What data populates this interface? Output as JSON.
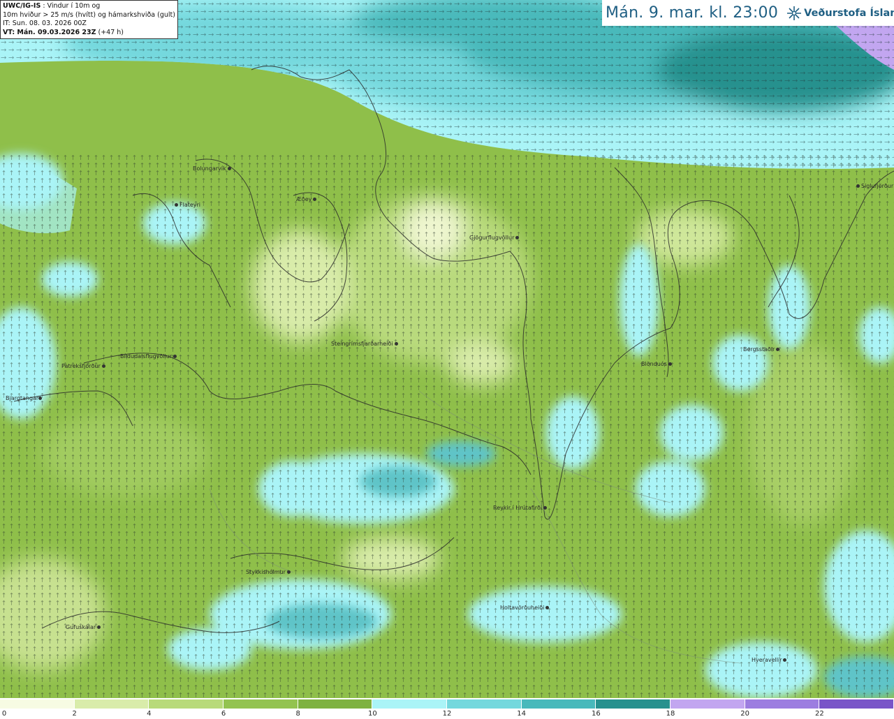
{
  "info": {
    "model": "UWC/IG-IS",
    "line1_rest": " : Vindur í 10m og",
    "line2": "10m hviður > 25 m/s (hvítt) og hámarkshviða (gult)",
    "line3": "IT: Sun. 08. 03. 2026 00Z",
    "vt_bold": "VT: Mán. 09.03.2026 23Z",
    "vt_rest": " (+47 h)"
  },
  "header": {
    "datetime": "Mán. 9. mar. kl. 23:00",
    "brand": "Veðurstofa Íslands",
    "logo_icon": "snowflake-compass-icon"
  },
  "places": [
    {
      "name": "Bolungarvík"
    },
    {
      "name": "Flateyri"
    },
    {
      "name": "Æðey"
    },
    {
      "name": "Gjögurflugvöllur"
    },
    {
      "name": "Siglufjörður"
    },
    {
      "name": "Steingrímsfjarðarheiði"
    },
    {
      "name": "Bíldudalsflugvöllur"
    },
    {
      "name": "Patreksfjörður"
    },
    {
      "name": "Bjargtangar"
    },
    {
      "name": "Blönduós"
    },
    {
      "name": "Bergsstaðir"
    },
    {
      "name": "Reykir í Hrútafirði"
    },
    {
      "name": "Stykkishólmur"
    },
    {
      "name": "Holtavörðuheiði"
    },
    {
      "name": "Gufuskálar"
    },
    {
      "name": "Hveravellir"
    }
  ],
  "legend": {
    "unit_colors": [
      "#f7fbe3",
      "#d9ecaa",
      "#b8da7a",
      "#93c350",
      "#7fb241",
      "#aaf4f7",
      "#74d8dd",
      "#48b9bb",
      "#27918e",
      "#c2a6f0",
      "#9c7de0",
      "#7955c8",
      "#4b2aa0"
    ],
    "ticks": [
      "0",
      "2",
      "4",
      "6",
      "8",
      "10",
      "12",
      "14",
      "16",
      "18",
      "20",
      "22"
    ]
  }
}
